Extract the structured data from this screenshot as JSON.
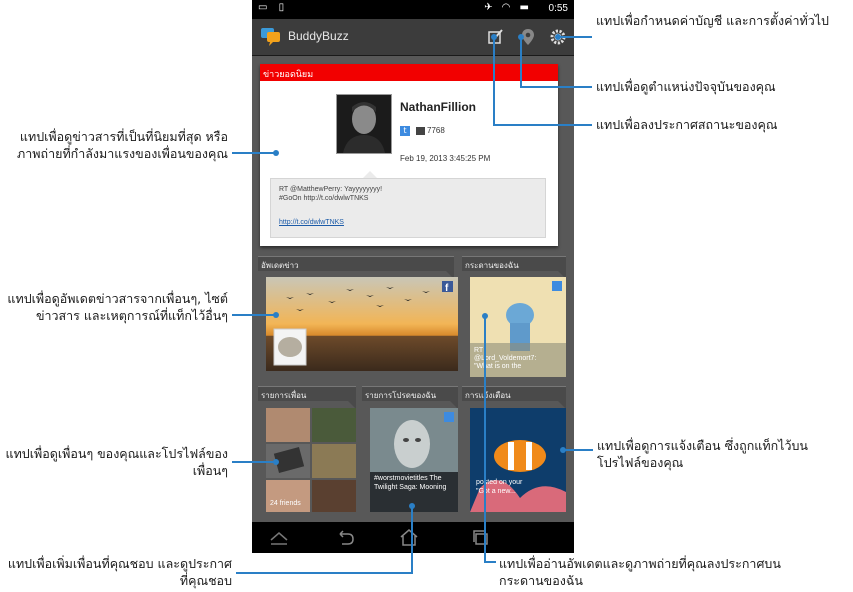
{
  "status_bar": {
    "time": "0:55"
  },
  "app": {
    "title": "BuddyBuzz"
  },
  "hot_news": {
    "header": "ข่าวยอดนิยม",
    "user_name": "NathanFillion",
    "retweet_count": "7768",
    "date": "Feb 19, 2013 3:45:25 PM",
    "tweet_line1": "RT @MatthewPerry: Yayyyyyyyy!",
    "tweet_line2": "#GoOn http://t.co/dwlwTNKS",
    "tweet_link": "http://t.co/dwlwTNKS"
  },
  "tiles": {
    "news_update": {
      "header": "อัพเดตข่าว"
    },
    "my_wall": {
      "header": "กระดานของฉัน",
      "caption1": "RT",
      "caption2": "@Lord_Voldemort7:",
      "caption3": "\"What is on the"
    },
    "friends_list": {
      "header": "รายการเพื่อน",
      "friends_count": "24 friends"
    },
    "my_favorites": {
      "header": "รายการโปรดของฉัน",
      "caption": "#worstmovietitles The Twilight Saga: Mooning"
    },
    "notifications": {
      "header": "การแจ้งเตือน",
      "caption1": "posted on your",
      "caption2": "\"Got a new..."
    }
  },
  "annotations": {
    "settings": "แทปเพื่อกำหนดค่าบัญชี และการตั้งค่าทั่วไป",
    "location": "แทปเพื่อดูตำแหน่งปัจจุบันของคุณ",
    "status": "แทปเพื่อลงประกาศสถานะของคุณ",
    "hot_news": "แทปเพื่อดูข่าวสารที่เป็นที่นิยมที่สุด หรือภาพถ่ายที่กำลังมาแรงของเพื่อนของคุณ",
    "news_update": "แทปเพื่อดูอัพเดตข่าวสารจากเพื่อนๆ, ไซต์ข่าวสาร และเหตุการณ์ที่แท็กไว้อื่นๆ",
    "friends": "แทปเพื่อดูเพื่อนๆ ของคุณและโปรไฟล์ของเพื่อนๆ",
    "favorites": "แทปเพื่อเพิ่มเพื่อนที่คุณชอบ และดูประกาศที่คุณชอบ",
    "notifications": "แทปเพื่อดูการแจ้งเตือน ซึ่งถูกแท็กไว้บนโปรไฟล์ของคุณ",
    "wall": "แทปเพื่ออ่านอัพเดตและดูภาพถ่ายที่คุณลงประกาศบน กระดานของฉัน"
  },
  "colors": {
    "accent": "#2a7fc6",
    "hot_header": "#f20000"
  },
  "icons": [
    "buddybuzz-logo-icon",
    "compose-icon",
    "location-pin-icon",
    "gear-icon",
    "back-icon",
    "home-icon",
    "recent-apps-icon",
    "facebook-icon",
    "twitter-icon"
  ]
}
